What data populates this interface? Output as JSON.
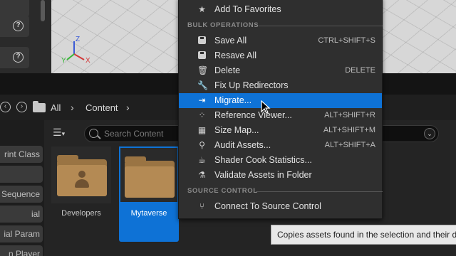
{
  "viewport": {
    "side_help_icons": [
      "?",
      "?"
    ],
    "gizmo": {
      "x_label": "X",
      "y_label": "Y",
      "z_label": "Z"
    }
  },
  "breadcrumb": {
    "back_icon": "arrow-left-circle-icon",
    "forward_icon": "arrow-right-circle-icon",
    "items": [
      "All",
      "Content"
    ]
  },
  "search": {
    "placeholder": "Search Content"
  },
  "left_panel": {
    "items": [
      "rint Class",
      "",
      "Sequence",
      "ial",
      "ial Param",
      "n Player"
    ]
  },
  "assets": [
    {
      "label": "Developers",
      "selected": false
    },
    {
      "label": "Mytaverse",
      "selected": true
    }
  ],
  "menu": {
    "top_item": {
      "label": "Add To Favorites",
      "icon": "star-icon"
    },
    "section_bulk": "BULK OPERATIONS",
    "bulk_items": [
      {
        "label": "Save All",
        "shortcut": "CTRL+SHIFT+S",
        "icon": "disk-icon"
      },
      {
        "label": "Resave All",
        "shortcut": "",
        "icon": "disk-icon"
      },
      {
        "label": "Delete",
        "shortcut": "DELETE",
        "icon": "trash-icon"
      },
      {
        "label": "Fix Up Redirectors",
        "shortcut": "",
        "icon": "wrench-icon"
      },
      {
        "label": "Migrate...",
        "shortcut": "",
        "icon": "migrate-icon",
        "highlighted": true
      },
      {
        "label": "Reference Viewer...",
        "shortcut": "ALT+SHIFT+R",
        "icon": "reference-viewer-icon"
      },
      {
        "label": "Size Map...",
        "shortcut": "ALT+SHIFT+M",
        "icon": "size-map-icon"
      },
      {
        "label": "Audit Assets...",
        "shortcut": "ALT+SHIFT+A",
        "icon": "audit-icon"
      },
      {
        "label": "Shader Cook Statistics...",
        "shortcut": "",
        "icon": "teapot-icon"
      },
      {
        "label": "Validate Assets in Folder",
        "shortcut": "",
        "icon": "flask-icon"
      }
    ],
    "section_source": "SOURCE CONTROL",
    "source_items": [
      {
        "label": "Connect To Source Control",
        "shortcut": "",
        "icon": "source-control-icon"
      }
    ]
  },
  "tooltip": {
    "text": "Copies assets found in the selection and their dependencies"
  },
  "colors": {
    "highlight": "#0e72d6",
    "menu_bg": "#2f2f2f",
    "folder": "#b48a54"
  }
}
